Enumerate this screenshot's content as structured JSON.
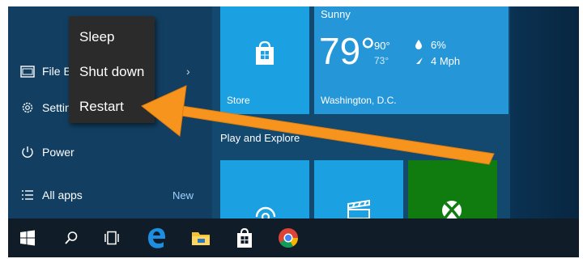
{
  "context_menu": {
    "items": [
      {
        "label": "Sleep"
      },
      {
        "label": "Shut down"
      },
      {
        "label": "Restart"
      }
    ]
  },
  "start_menu": {
    "items": [
      {
        "label": "File Ex",
        "icon": "file-explorer-icon"
      },
      {
        "label": "Settin",
        "icon": "gear-icon"
      },
      {
        "label": "Power",
        "icon": "power-icon"
      },
      {
        "label": "All apps",
        "icon": "all-apps-icon"
      }
    ],
    "new_badge": "New",
    "chevron": "›"
  },
  "tiles": {
    "store": {
      "label": "Store"
    },
    "weather": {
      "condition": "Sunny",
      "temperature": "79°",
      "high": "90°",
      "low": "73°",
      "precip": "6%",
      "wind": "4 Mph",
      "location": "Washington, D.C."
    },
    "group_label": "Play and Explore"
  },
  "taskbar": {
    "items": [
      "start-icon",
      "search-icon",
      "task-view-icon",
      "edge-icon",
      "file-explorer-icon",
      "store-icon",
      "chrome-icon"
    ]
  },
  "colors": {
    "accent_orange": "#f7941d",
    "tile_blue": "#1ba1e2",
    "tile_green": "#107c10",
    "taskbar": "#111c29"
  }
}
